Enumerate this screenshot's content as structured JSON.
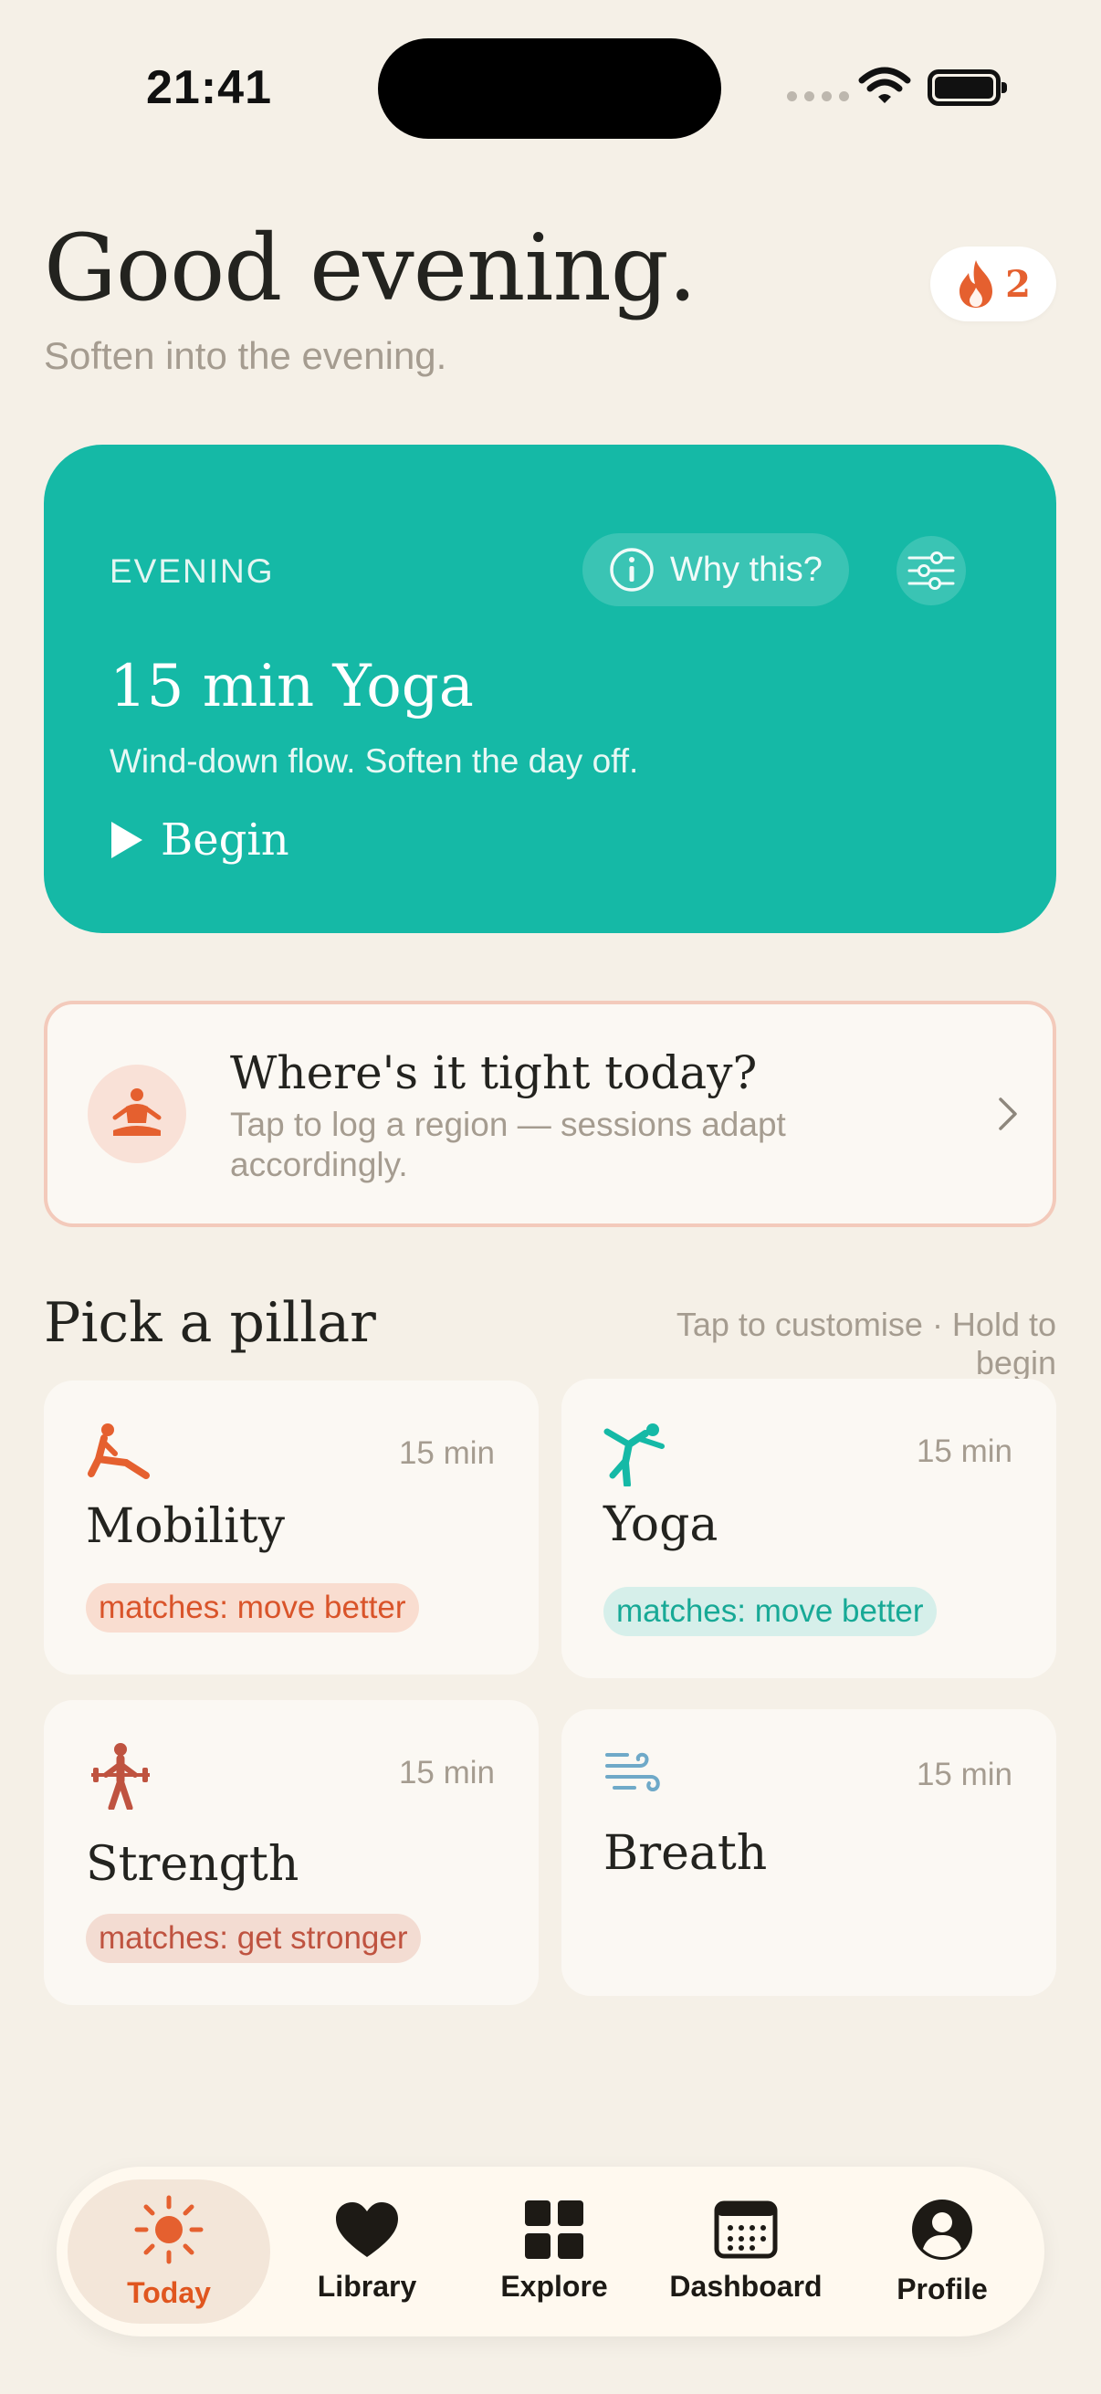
{
  "status_bar": {
    "time": "21:41"
  },
  "header": {
    "greeting": "Good evening.",
    "subtitle": "Soften into the evening.",
    "streak_count": "2"
  },
  "hero": {
    "eyebrow": "EVENING",
    "why_label": "Why this?",
    "title": "15 min Yoga",
    "description": "Wind-down flow. Soften the day off.",
    "begin_label": "Begin"
  },
  "tight_card": {
    "title": "Where's it tight today?",
    "description": "Tap to log a region — sessions adapt accordingly."
  },
  "pillars": {
    "heading": "Pick a pillar",
    "hint": "Tap to customise · Hold to begin",
    "items": [
      {
        "name": "Mobility",
        "duration": "15 min",
        "tag": "matches: move better",
        "icon": "stretch-icon"
      },
      {
        "name": "Yoga",
        "duration": "15 min",
        "tag": "matches: move better",
        "icon": "yoga-pose-icon"
      },
      {
        "name": "Strength",
        "duration": "15 min",
        "tag": "matches: get stronger",
        "icon": "weightlifter-icon"
      },
      {
        "name": "Breath",
        "duration": "15 min",
        "icon": "wind-icon"
      }
    ]
  },
  "tabbar": {
    "items": [
      {
        "label": "Today",
        "icon": "sun-icon",
        "active": true
      },
      {
        "label": "Library",
        "icon": "heart-icon"
      },
      {
        "label": "Explore",
        "icon": "grid-icon"
      },
      {
        "label": "Dashboard",
        "icon": "calendar-icon"
      },
      {
        "label": "Profile",
        "icon": "person-icon"
      }
    ]
  },
  "colors": {
    "background": "#F5F0E7",
    "accent_teal": "#15B9A6",
    "accent_orange": "#E5602F",
    "strength_red": "#BF5340",
    "breath_blue": "#6FA9C8",
    "muted_text": "#A59C90"
  }
}
